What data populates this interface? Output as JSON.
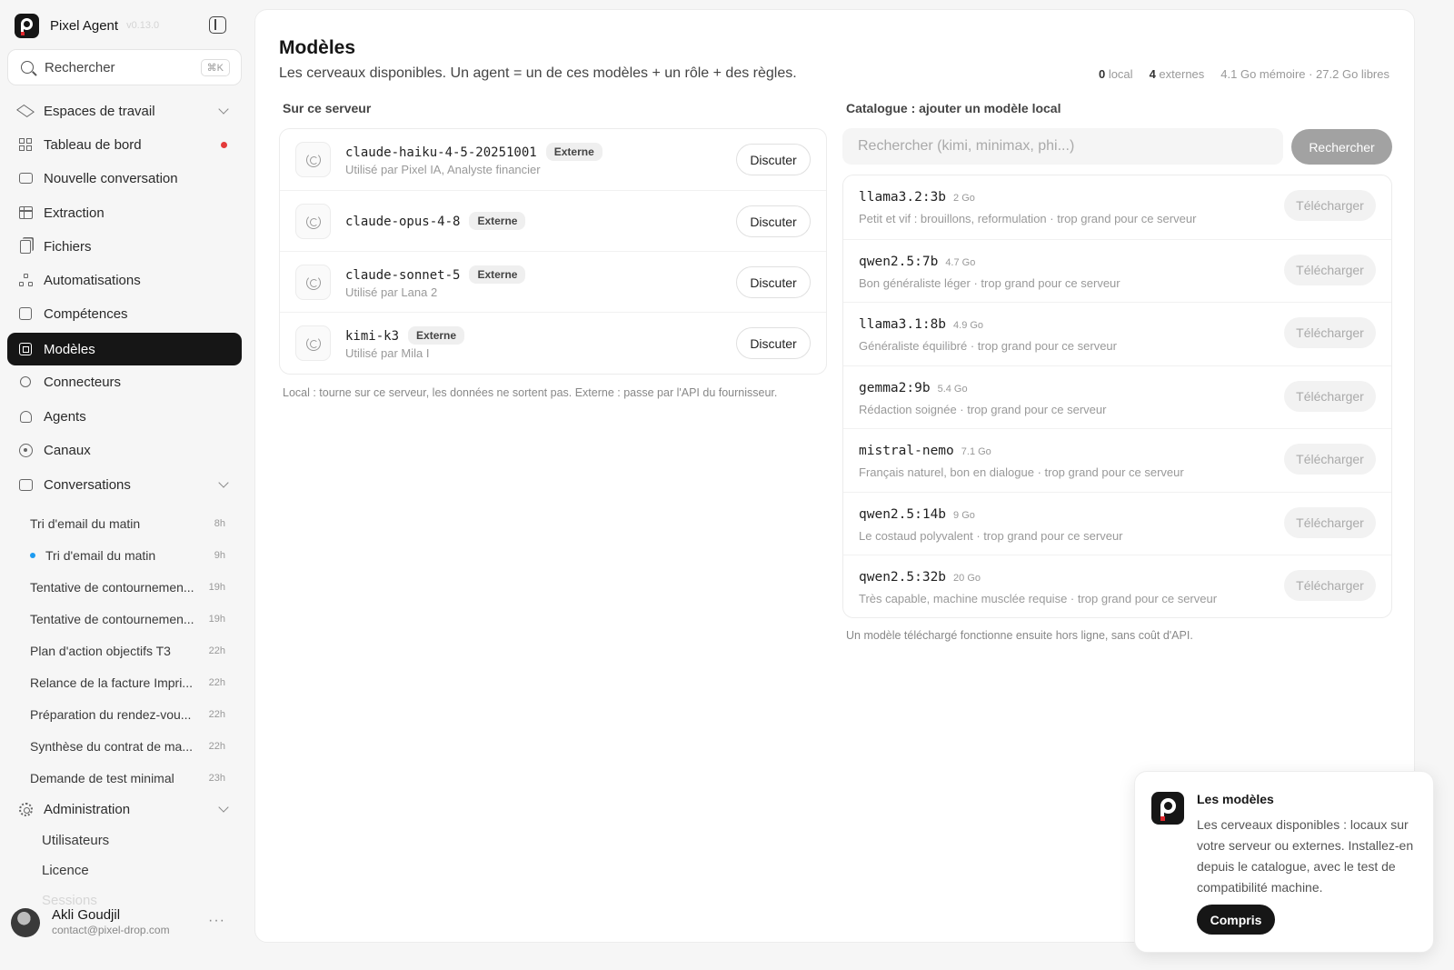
{
  "app": {
    "name": "Pixel Agent",
    "version": "v0.13.0"
  },
  "sidebar": {
    "search": {
      "label": "Rechercher",
      "shortcut": "⌘K"
    },
    "nav": [
      {
        "label": "Espaces de travail",
        "icon": "layers-icon"
      },
      {
        "label": "Tableau de bord",
        "icon": "grid-icon"
      },
      {
        "label": "Nouvelle conversation",
        "icon": "chat-plus-icon"
      },
      {
        "label": "Extraction",
        "icon": "table-icon"
      },
      {
        "label": "Fichiers",
        "icon": "files-icon"
      },
      {
        "label": "Automatisations",
        "icon": "workflow-icon"
      },
      {
        "label": "Compétences",
        "icon": "puzzle-icon"
      },
      {
        "label": "Modèles",
        "icon": "chip-icon"
      },
      {
        "label": "Connecteurs",
        "icon": "plug-icon"
      },
      {
        "label": "Agents",
        "icon": "agent-icon"
      },
      {
        "label": "Canaux",
        "icon": "broadcast-icon"
      },
      {
        "label": "Conversations",
        "icon": "conversations-icon"
      }
    ],
    "conversations": [
      {
        "title": "Tri d'email du matin",
        "time": "8h"
      },
      {
        "title": "Tri d'email du matin",
        "time": "9h"
      },
      {
        "title": "Tentative de contournemen...",
        "time": "19h"
      },
      {
        "title": "Tentative de contournemen...",
        "time": "19h"
      },
      {
        "title": "Plan d'action objectifs T3",
        "time": "22h"
      },
      {
        "title": "Relance de la facture Impri...",
        "time": "22h"
      },
      {
        "title": "Préparation du rendez-vou...",
        "time": "22h"
      },
      {
        "title": "Synthèse du contrat de ma...",
        "time": "22h"
      },
      {
        "title": "Demande de test minimal",
        "time": "23h"
      }
    ],
    "admin": {
      "label": "Administration",
      "items": [
        "Utilisateurs",
        "Licence",
        "Sessions"
      ]
    },
    "user": {
      "name": "Akli Goudjil",
      "email": "contact@pixel-drop.com",
      "more": "···"
    }
  },
  "page": {
    "title": "Modèles",
    "subtitle": "Les cerveaux disponibles. Un agent = un de ces modèles + un rôle + des règles.",
    "stats": {
      "local_count": "0",
      "local_label": "local",
      "external_count": "4",
      "external_label": "externes",
      "memory": "4.1 Go mémoire · 27.2 Go libres"
    }
  },
  "server": {
    "label": "Sur ce serveur",
    "models": [
      {
        "name": "claude-haiku-4-5-20251001",
        "badge": "Externe",
        "usage": "Utilisé par Pixel IA, Analyste financier",
        "action": "Discuter"
      },
      {
        "name": "claude-opus-4-8",
        "badge": "Externe",
        "usage": "",
        "action": "Discuter"
      },
      {
        "name": "claude-sonnet-5",
        "badge": "Externe",
        "usage": "Utilisé par Lana 2",
        "action": "Discuter"
      },
      {
        "name": "kimi-k3",
        "badge": "Externe",
        "usage": "Utilisé par Mila I",
        "action": "Discuter"
      }
    ],
    "footnote": "Local : tourne sur ce serveur, les données ne sortent pas. Externe : passe par l'API du fournisseur."
  },
  "catalog": {
    "label": "Catalogue : ajouter un modèle local",
    "search_placeholder": "Rechercher (kimi, minimax, phi...)",
    "search_button": "Rechercher",
    "download_label": "Télécharger",
    "models": [
      {
        "name": "llama3.2:3b",
        "size": "2 Go",
        "desc": "Petit et vif : brouillons, reformulation · trop grand pour ce serveur"
      },
      {
        "name": "qwen2.5:7b",
        "size": "4.7 Go",
        "desc": "Bon généraliste léger · trop grand pour ce serveur"
      },
      {
        "name": "llama3.1:8b",
        "size": "4.9 Go",
        "desc": "Généraliste équilibré · trop grand pour ce serveur"
      },
      {
        "name": "gemma2:9b",
        "size": "5.4 Go",
        "desc": "Rédaction soignée · trop grand pour ce serveur"
      },
      {
        "name": "mistral-nemo",
        "size": "7.1 Go",
        "desc": "Français naturel, bon en dialogue · trop grand pour ce serveur"
      },
      {
        "name": "qwen2.5:14b",
        "size": "9 Go",
        "desc": "Le costaud polyvalent · trop grand pour ce serveur"
      },
      {
        "name": "qwen2.5:32b",
        "size": "20 Go",
        "desc": "Très capable, machine musclée requise · trop grand pour ce serveur"
      }
    ],
    "footnote": "Un modèle téléchargé fonctionne ensuite hors ligne, sans coût d'API."
  },
  "tooltip": {
    "title": "Les modèles",
    "body": "Les cerveaux disponibles : locaux sur votre serveur ou externes. Installez-en depuis le catalogue, avec le test de compatibilité machine.",
    "button": "Compris"
  },
  "colors": {
    "accent": "#161616",
    "notification": "#e43b3b",
    "unread": "#1d9bf0",
    "brand_red": "#e0282e"
  }
}
